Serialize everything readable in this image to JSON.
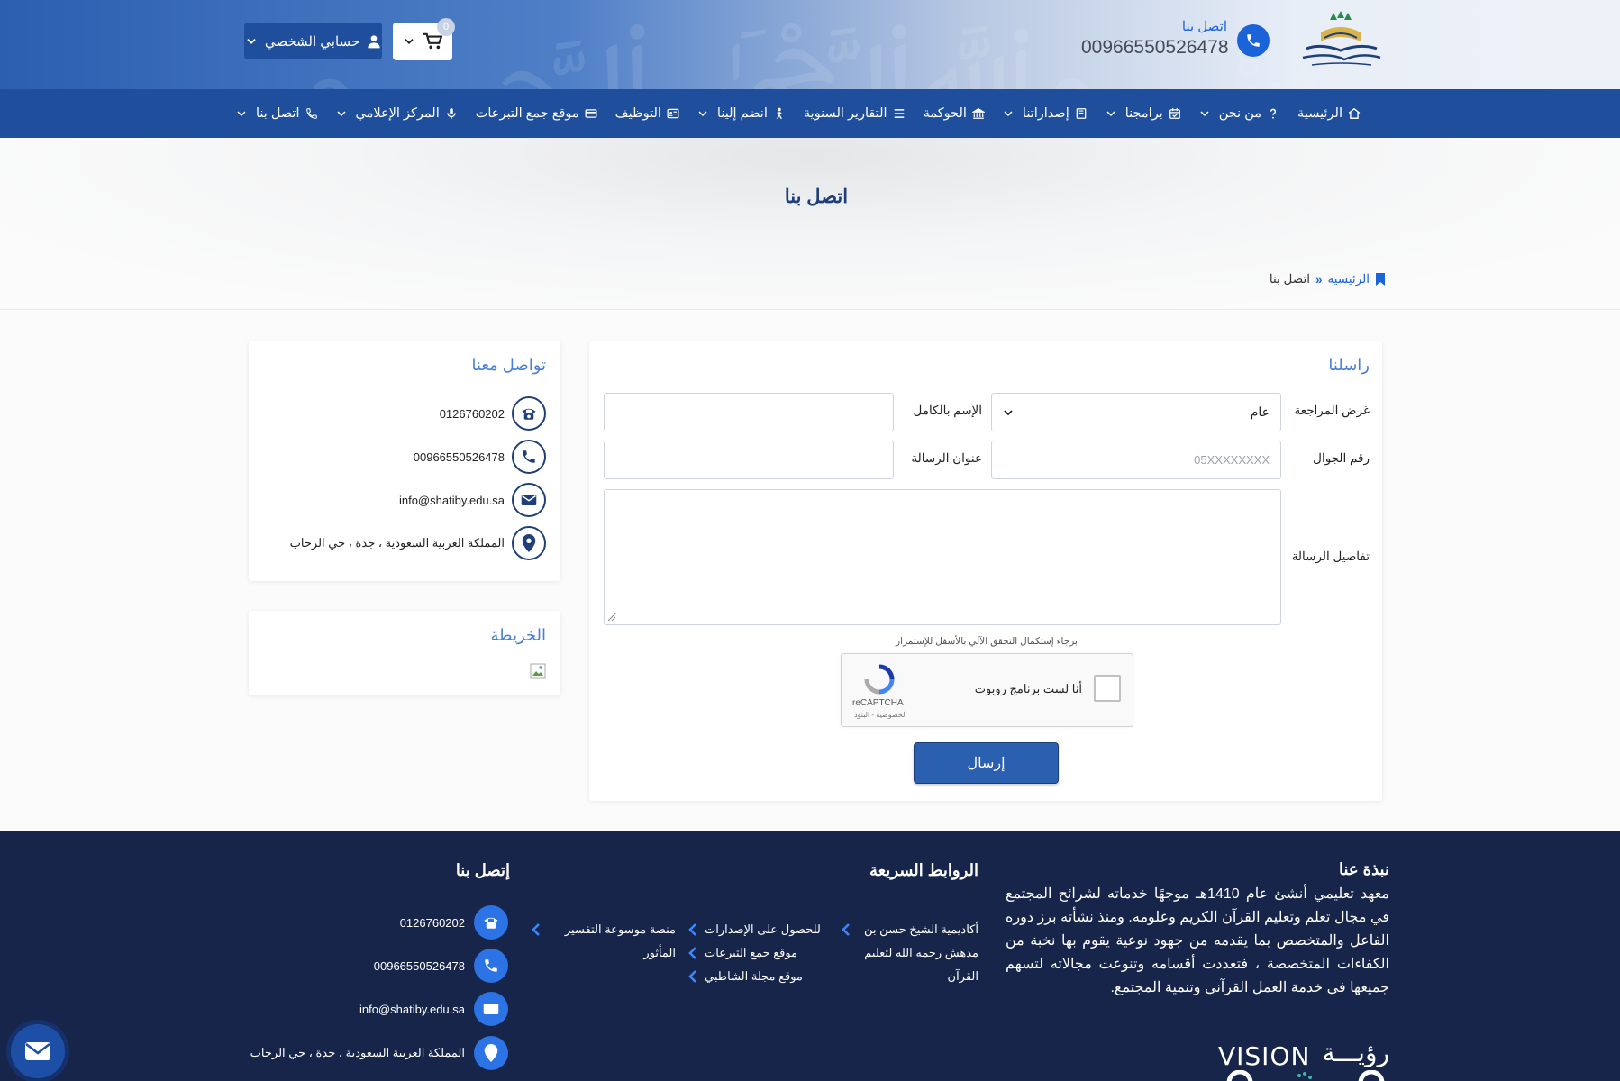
{
  "header": {
    "call_label": "اتصل بنا",
    "call_phone": "00966550526478",
    "cart_count": "0",
    "account_label": "حسابي الشخصي"
  },
  "nav": {
    "items": [
      {
        "label": "الرئيسية",
        "icon": "home-icon",
        "dropdown": false
      },
      {
        "label": "من نحن",
        "icon": "question-icon",
        "dropdown": true
      },
      {
        "label": "برامجنا",
        "icon": "calendar-check-icon",
        "dropdown": true
      },
      {
        "label": "إصداراتنا",
        "icon": "book-icon",
        "dropdown": true
      },
      {
        "label": "الحوكمة",
        "icon": "bank-icon",
        "dropdown": false
      },
      {
        "label": "التقارير السنوية",
        "icon": "list-icon",
        "dropdown": false
      },
      {
        "label": "انضم إلينا",
        "icon": "person-icon",
        "dropdown": true
      },
      {
        "label": "التوظيف",
        "icon": "id-card-icon",
        "dropdown": false
      },
      {
        "label": "موقع جمع التبرعات",
        "icon": "credit-card-icon",
        "dropdown": false
      },
      {
        "label": "المركز الإعلامي",
        "icon": "microphone-icon",
        "dropdown": true
      },
      {
        "label": "اتصل بنا",
        "icon": "phone-icon",
        "dropdown": true
      }
    ]
  },
  "banner": {
    "title": "اتصل بنا",
    "breadcrumb_home": "الرئيسية",
    "breadcrumb_sep": "»",
    "breadcrumb_current": "اتصل بنا"
  },
  "form": {
    "title": "راسلنا",
    "purpose_label": "غرض المراجعة",
    "purpose_value": "عام",
    "fullname_label": "الإسم بالكامل",
    "mobile_label": "رقم الجوال",
    "mobile_placeholder": "05XXXXXXXX",
    "subject_label": "عنوان الرسالة",
    "details_label": "تفاصيل الرسالة",
    "captcha_note": "برجاء إستكمال التحقق الآلي بالأسفل للإستمرار",
    "captcha_text": "أنا لست برنامج روبوت",
    "captcha_brand": "reCAPTCHA",
    "captcha_terms": "الخصوصية - البنود",
    "submit_label": "إرسال"
  },
  "contact_card": {
    "title": "تواصل معنا",
    "items": [
      {
        "icon": "telephone-icon",
        "text": "0126760202"
      },
      {
        "icon": "phone-icon",
        "text": "00966550526478"
      },
      {
        "icon": "envelope-icon",
        "text": "info@shatiby.edu.sa"
      },
      {
        "icon": "location-pin-icon",
        "text": "المملكة العربية السعودية ، جدة ، حي الرحاب"
      }
    ]
  },
  "map_card": {
    "title": "الخريطة"
  },
  "footer": {
    "about_title": "نبذة عنا",
    "about_text": "معهد تعليمي أنشئ عام 1410هـ موجهًا خدماته لشرائح المجتمع في مجال تعلم وتعليم القرآن الكريم وعلومه. ومنذ نشأته برز دوره الفاعل والمتخصص بما يقدمه من جهود نوعية يقوم بها نخبة من الكفاءات المتخصصة ، فتعددت أقسامه وتنوعت مجالاته لتسهم جميعها في خدمة العمل القرآني وتنمية المجتمع.",
    "links_title": "الروابط السريعة",
    "links": [
      "أكاديمية الشيخ حسن بن مدهش رحمه الله لتعليم القرآن",
      "للحصول على الإصدارات",
      "موقع جمع التبرعات",
      "موقع مجلة الشاطبي",
      "منصة موسوعة التفسير المأثور"
    ],
    "contact_title": "إتصل بنا",
    "contacts": [
      {
        "icon": "telephone-icon",
        "text": "0126760202"
      },
      {
        "icon": "phone-icon",
        "text": "00966550526478"
      },
      {
        "icon": "envelope-icon",
        "text": "info@shatiby.edu.sa"
      },
      {
        "icon": "location-pin-icon",
        "text": "المملكة العربية السعودية ، جدة ، حي الرحاب"
      }
    ],
    "vision_en": "VISION",
    "vision_ar": "رؤيـــة"
  },
  "colors": {
    "primary": "#1f4f9c",
    "accent": "#1b63d9",
    "footer_bg": "#17254a"
  }
}
